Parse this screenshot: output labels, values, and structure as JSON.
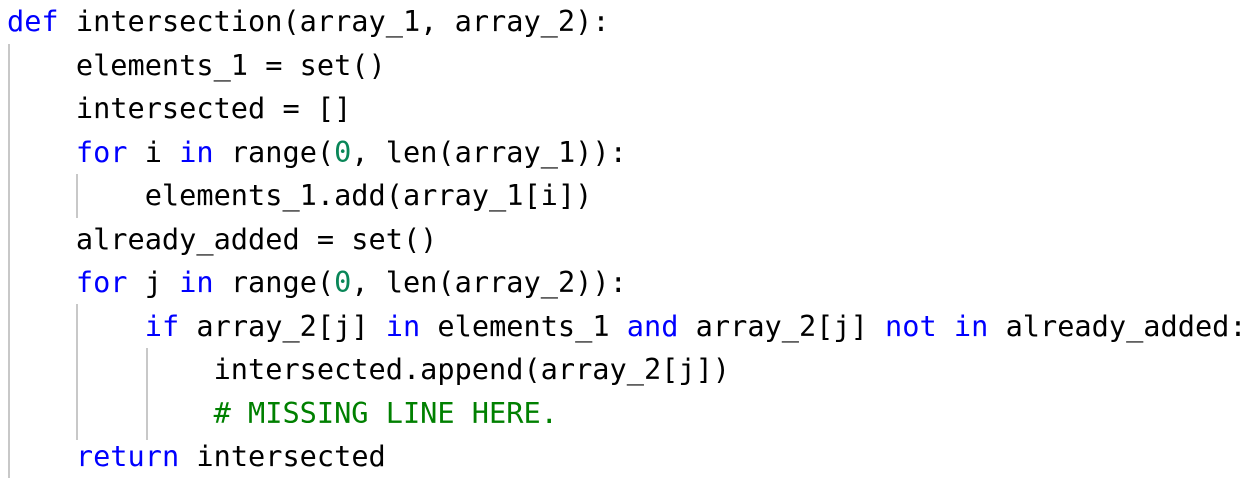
{
  "editor": {
    "lines": [
      {
        "tokens": [
          {
            "type": "kw",
            "text": "def"
          },
          {
            "type": "plain",
            "text": " intersection(array_1, array_2):"
          }
        ]
      },
      {
        "tokens": [
          {
            "type": "plain",
            "text": "    elements_1 = set()"
          }
        ]
      },
      {
        "tokens": [
          {
            "type": "plain",
            "text": "    intersected = []"
          }
        ]
      },
      {
        "tokens": [
          {
            "type": "plain",
            "text": "    "
          },
          {
            "type": "kw",
            "text": "for"
          },
          {
            "type": "plain",
            "text": " i "
          },
          {
            "type": "kw",
            "text": "in"
          },
          {
            "type": "plain",
            "text": " range("
          },
          {
            "type": "num",
            "text": "0"
          },
          {
            "type": "plain",
            "text": ", len(array_1)):"
          }
        ]
      },
      {
        "tokens": [
          {
            "type": "plain",
            "text": "        elements_1.add(array_1[i])"
          }
        ]
      },
      {
        "tokens": [
          {
            "type": "plain",
            "text": "    already_added = set()"
          }
        ]
      },
      {
        "tokens": [
          {
            "type": "plain",
            "text": "    "
          },
          {
            "type": "kw",
            "text": "for"
          },
          {
            "type": "plain",
            "text": " j "
          },
          {
            "type": "kw",
            "text": "in"
          },
          {
            "type": "plain",
            "text": " range("
          },
          {
            "type": "num",
            "text": "0"
          },
          {
            "type": "plain",
            "text": ", len(array_2)):"
          }
        ]
      },
      {
        "tokens": [
          {
            "type": "plain",
            "text": "        "
          },
          {
            "type": "kw",
            "text": "if"
          },
          {
            "type": "plain",
            "text": " array_2[j] "
          },
          {
            "type": "kw",
            "text": "in"
          },
          {
            "type": "plain",
            "text": " elements_1 "
          },
          {
            "type": "kw",
            "text": "and"
          },
          {
            "type": "plain",
            "text": " array_2[j] "
          },
          {
            "type": "kw",
            "text": "not"
          },
          {
            "type": "plain",
            "text": " "
          },
          {
            "type": "kw",
            "text": "in"
          },
          {
            "type": "plain",
            "text": " already_added:"
          }
        ]
      },
      {
        "tokens": [
          {
            "type": "plain",
            "text": "            intersected.append(array_2[j])"
          }
        ]
      },
      {
        "tokens": [
          {
            "type": "cm",
            "text": "            # MISSING LINE HERE."
          }
        ]
      },
      {
        "tokens": [
          {
            "type": "plain",
            "text": "    "
          },
          {
            "type": "kw",
            "text": "return"
          },
          {
            "type": "plain",
            "text": " intersected"
          }
        ]
      }
    ]
  },
  "colors": {
    "keyword": "#0000ff",
    "number": "#098658",
    "comment": "#008000",
    "text": "#000000",
    "indent_guide": "#c8c8c8",
    "background": "#ffffff"
  }
}
